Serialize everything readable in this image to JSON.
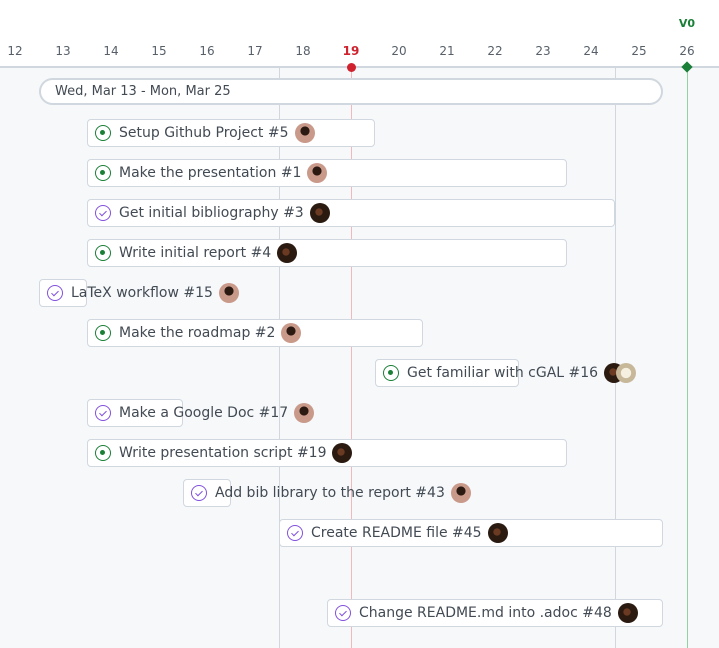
{
  "timeline": {
    "days": [
      "12",
      "13",
      "14",
      "15",
      "16",
      "17",
      "18",
      "19",
      "20",
      "21",
      "22",
      "23",
      "24",
      "25",
      "26"
    ],
    "today": "19",
    "milestone": "V0",
    "range_label": "Wed, Mar 13 - Mon, Mar 25"
  },
  "colors": {
    "open": "#1a7f37",
    "done": "#8250df",
    "today": "#cf222e",
    "milestone": "#1a7f37"
  },
  "items": [
    {
      "title": "Setup Github Project #5",
      "status": "open",
      "avatars": [
        "user-a"
      ]
    },
    {
      "title": "Make the presentation #1",
      "status": "open",
      "avatars": [
        "user-a"
      ]
    },
    {
      "title": "Get initial bibliography #3",
      "status": "done",
      "avatars": [
        "user-b"
      ]
    },
    {
      "title": "Write initial report #4",
      "status": "open",
      "avatars": [
        "user-b"
      ]
    },
    {
      "title": "LaTeX workflow #15",
      "status": "done",
      "avatars": [
        "user-a"
      ]
    },
    {
      "title": "Make the roadmap #2",
      "status": "open",
      "avatars": [
        "user-a"
      ]
    },
    {
      "title": "Get familiar with cGAL #16",
      "status": "open",
      "avatars": [
        "user-b",
        "user-c"
      ]
    },
    {
      "title": "Make a Google Doc #17",
      "status": "done",
      "avatars": [
        "user-a"
      ]
    },
    {
      "title": "Write presentation script #19",
      "status": "open",
      "avatars": [
        "user-b"
      ]
    },
    {
      "title": "Add bib library to the report #43",
      "status": "done",
      "avatars": [
        "user-a"
      ]
    },
    {
      "title": "Create README file #45",
      "status": "done",
      "avatars": [
        "user-b"
      ]
    },
    {
      "title": "Change README.md into .adoc #48",
      "status": "done",
      "avatars": [
        "user-b"
      ]
    }
  ]
}
